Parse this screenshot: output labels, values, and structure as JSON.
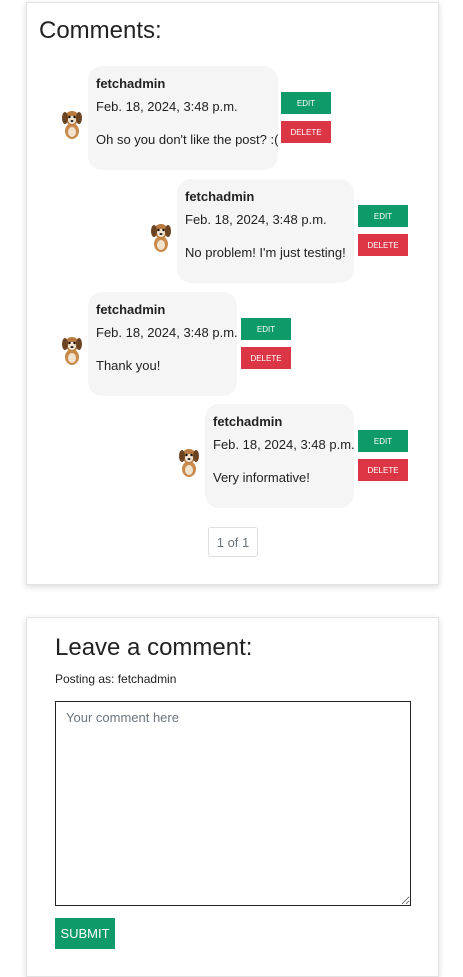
{
  "comments_section": {
    "title": "Comments:",
    "edit_label": "EDIT",
    "delete_label": "DELETE",
    "comments": [
      {
        "author": "fetchadmin",
        "date": "Feb. 18, 2024, 3:48 p.m.",
        "text": "Oh so you don't like the post? :("
      },
      {
        "author": "fetchadmin",
        "date": "Feb. 18, 2024, 3:48 p.m.",
        "text": "No problem! I'm just testing!"
      },
      {
        "author": "fetchadmin",
        "date": "Feb. 18, 2024, 3:48 p.m.",
        "text": "Thank you!"
      },
      {
        "author": "fetchadmin",
        "date": "Feb. 18, 2024, 3:48 p.m.",
        "text": "Very informative!"
      }
    ],
    "pagination": "1 of 1"
  },
  "comment_form": {
    "title": "Leave a comment:",
    "posting_as": "Posting as: fetchadmin",
    "placeholder": "Your comment here",
    "value": "",
    "submit_label": "SUBMIT"
  },
  "colors": {
    "edit": "#0f9a6a",
    "delete": "#dc3545",
    "bubble": "#f5f5f5",
    "submit": "#0f9a6a"
  },
  "icons": {
    "avatar": "puppy-avatar-icon"
  }
}
